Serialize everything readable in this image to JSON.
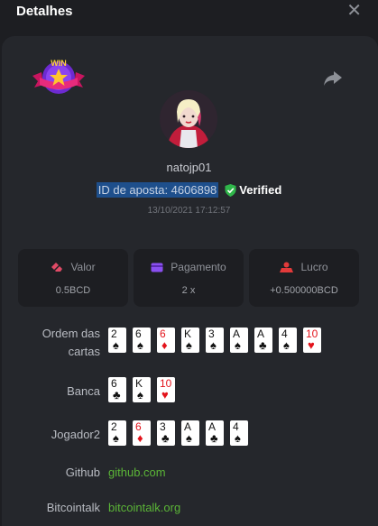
{
  "header": {
    "title": "Detalhes"
  },
  "player": {
    "username": "natojp01",
    "bet_id": "ID de aposta: 4606898",
    "verified": "Verified",
    "timestamp": "13/10/2021 17:12:57"
  },
  "badge": {
    "text": "WIN"
  },
  "stats": {
    "valor": {
      "label": "Valor",
      "value": "0.5BCD"
    },
    "pagamento": {
      "label": "Pagamento",
      "value": "2 x"
    },
    "lucro": {
      "label": "Lucro",
      "value": "+0.500000BCD"
    }
  },
  "rows": {
    "order_label_1": "Ordem das",
    "order_label_2": "cartas",
    "banca_label": "Banca",
    "jogador_label": "Jogador2",
    "github_label": "Github",
    "github_link": "github.com",
    "bitcointalk_label": "Bitcointalk",
    "bitcointalk_link": "bitcointalk.org"
  },
  "card_order": [
    {
      "rank": "2",
      "suit": "♠",
      "color": "black"
    },
    {
      "rank": "6",
      "suit": "♠",
      "color": "black"
    },
    {
      "rank": "6",
      "suit": "♦",
      "color": "red"
    },
    {
      "rank": "K",
      "suit": "♠",
      "color": "black"
    },
    {
      "rank": "3",
      "suit": "♠",
      "color": "black"
    },
    {
      "rank": "A",
      "suit": "♠",
      "color": "black"
    },
    {
      "rank": "A",
      "suit": "♣",
      "color": "black"
    },
    {
      "rank": "4",
      "suit": "♠",
      "color": "black"
    },
    {
      "rank": "10",
      "suit": "♥",
      "color": "red"
    }
  ],
  "banca_cards": [
    {
      "rank": "6",
      "suit": "♣",
      "color": "black"
    },
    {
      "rank": "K",
      "suit": "♠",
      "color": "black"
    },
    {
      "rank": "10",
      "suit": "♥",
      "color": "red"
    }
  ],
  "jogador_cards": [
    {
      "rank": "2",
      "suit": "♠",
      "color": "black"
    },
    {
      "rank": "6",
      "suit": "♦",
      "color": "red"
    },
    {
      "rank": "3",
      "suit": "♣",
      "color": "black"
    },
    {
      "rank": "A",
      "suit": "♠",
      "color": "black"
    },
    {
      "rank": "A",
      "suit": "♣",
      "color": "black"
    },
    {
      "rank": "4",
      "suit": "♠",
      "color": "black"
    }
  ],
  "colors": {
    "accent_green": "#5bb537",
    "highlight": "#1e4f8c",
    "verified_green": "#2fb64a"
  }
}
